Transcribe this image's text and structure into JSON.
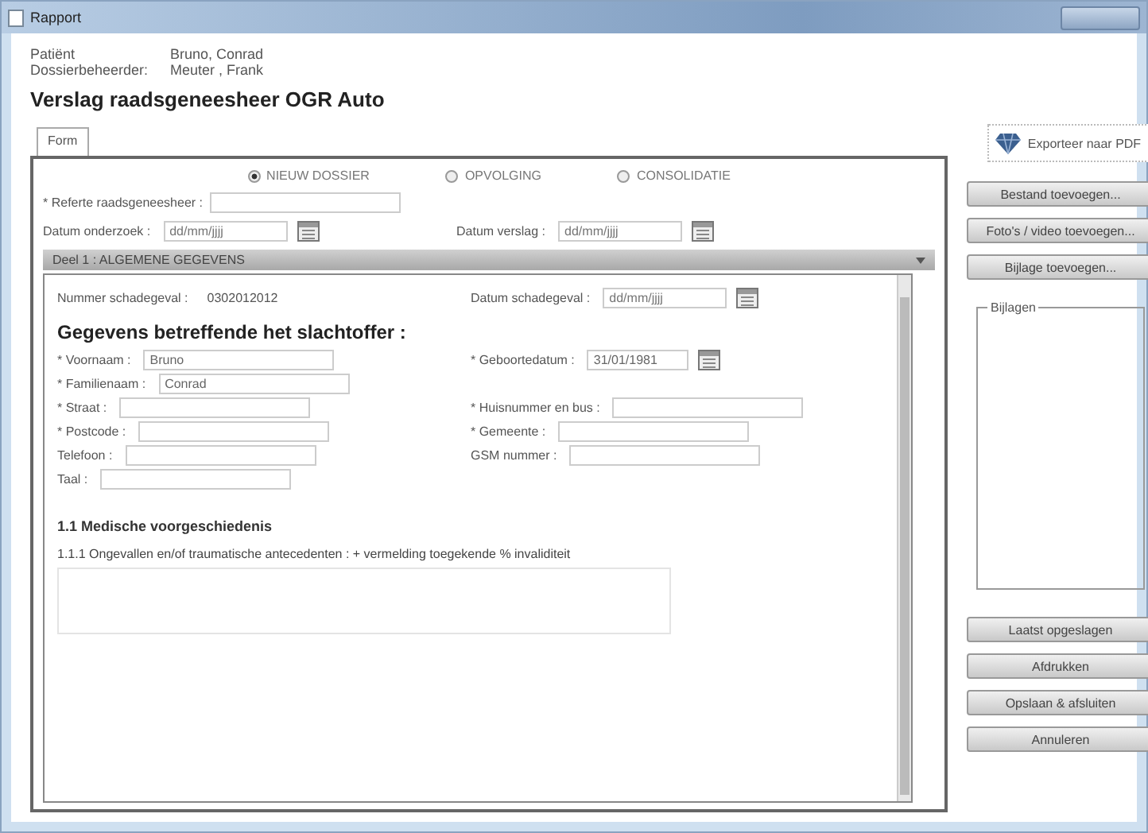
{
  "window": {
    "title": "Rapport"
  },
  "header": {
    "rows": [
      {
        "label": "Patiënt",
        "value": "Bruno, Conrad"
      },
      {
        "label": "Dossierbeheerder:",
        "value": "Meuter , Frank"
      }
    ],
    "title": "Verslag raadsgeneesheer OGR Auto"
  },
  "tabs": [
    {
      "label": "Form",
      "selected": true
    }
  ],
  "dossier_type": [
    {
      "label": "NIEUW DOSSIER",
      "selected": true
    },
    {
      "label": "OPVOLGING",
      "selected": false
    },
    {
      "label": "CONSOLIDATIE",
      "selected": false
    }
  ],
  "top_fields": [
    {
      "label": "* Referte raadsgeneesheer :",
      "kind": "text"
    },
    {
      "label": "Datum onderzoek :",
      "kind": "date",
      "placeholder": "dd/mm/jjjj"
    },
    {
      "label": "Datum verslag :",
      "kind": "date",
      "placeholder": "dd/mm/jjjj"
    }
  ],
  "section_bar": {
    "title": "Deel 1 : ALGEMENE GEGEVENS",
    "expanded": true
  },
  "claim": {
    "number_label": "Nummer schadegeval :",
    "number": "0302012012",
    "date_label": "Datum schadegeval :",
    "date_placeholder": "dd/mm/jjjj"
  },
  "victim": {
    "title": "Gegevens betreffende het slachtoffer :",
    "rows": [
      [
        {
          "label": "* Voornaam :",
          "value": "Bruno",
          "kind": "text"
        },
        {
          "label": "* Geboortedatum :",
          "value": "31/01/1981",
          "kind": "date"
        }
      ],
      [
        {
          "label": "* Familienaam :",
          "value": "Conrad",
          "kind": "text"
        }
      ],
      [
        {
          "label": "* Straat :",
          "kind": "text"
        },
        {
          "label": "* Huisnummer en bus :",
          "kind": "text"
        }
      ],
      [
        {
          "label": "* Postcode :",
          "kind": "text"
        },
        {
          "label": "* Gemeente :",
          "kind": "text"
        }
      ],
      [
        {
          "label": "Telefoon :",
          "kind": "text"
        },
        {
          "label": "GSM nummer :",
          "kind": "text"
        }
      ],
      [
        {
          "label": "Taal :",
          "kind": "text"
        }
      ]
    ]
  },
  "medical": {
    "title": "1.1 Medische voorgeschiedenis",
    "question": "1.1.1 Ongevallen en/of traumatische antecedenten : + vermelding toegekende % invaliditeit"
  },
  "side": {
    "export": "Exporteer naar PDF",
    "buttons": [
      "Bestand toevoegen...",
      "Foto's / video toevoegen...",
      "Bijlage toevoegen..."
    ],
    "attachments_title": "Bijlagen",
    "actions": [
      "Laatst opgeslagen",
      "Afdrukken",
      "Opslaan & afsluiten",
      "Annuleren"
    ]
  }
}
